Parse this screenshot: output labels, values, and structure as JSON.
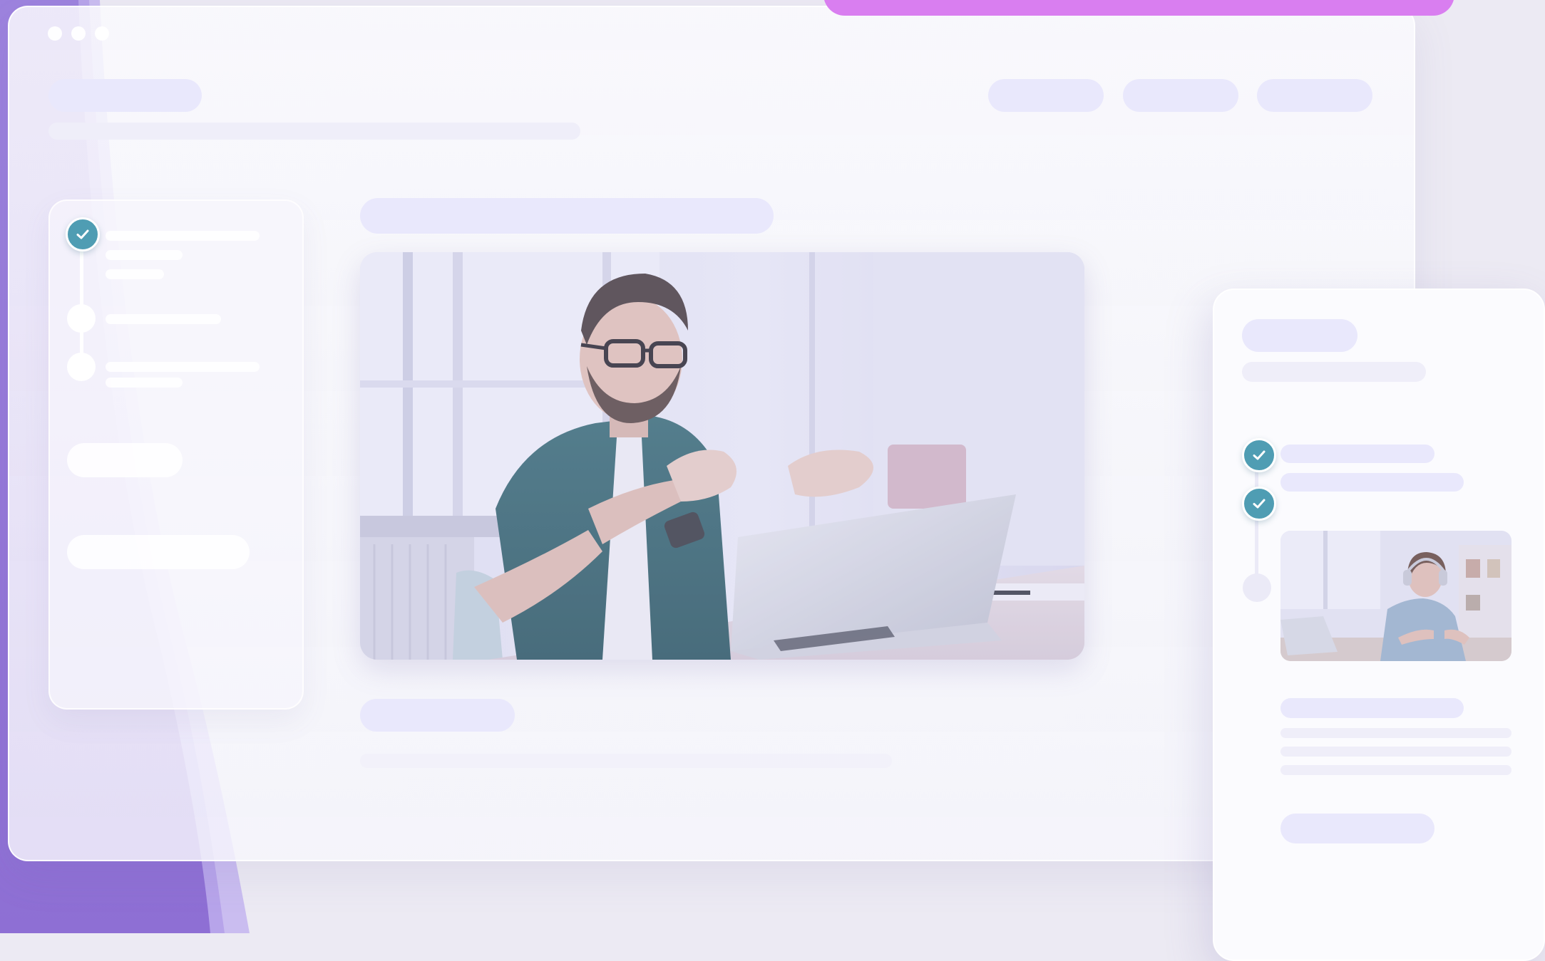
{
  "window": {
    "controls": [
      "window-dot",
      "window-dot",
      "window-dot"
    ]
  },
  "header": {
    "nav_buttons": [
      "",
      "",
      ""
    ]
  },
  "course_steps": [
    {
      "state": "completed",
      "icon": "check-icon"
    },
    {
      "state": "pending"
    },
    {
      "state": "pending"
    }
  ],
  "mobile_steps": [
    {
      "state": "completed",
      "icon": "check-icon"
    },
    {
      "state": "completed",
      "icon": "check-icon"
    },
    {
      "state": "pending"
    }
  ],
  "media": {
    "hero": "video-thumbnail-man-gesturing-at-laptop",
    "mobile_thumbnail": "video-thumbnail-woman-with-headphones"
  },
  "colors": {
    "brand_purple": "#8f72d6",
    "accent_magenta": "#d97ef0",
    "check_teal": "#4f9db3",
    "placeholder_lavender": "#e9e8fc"
  }
}
